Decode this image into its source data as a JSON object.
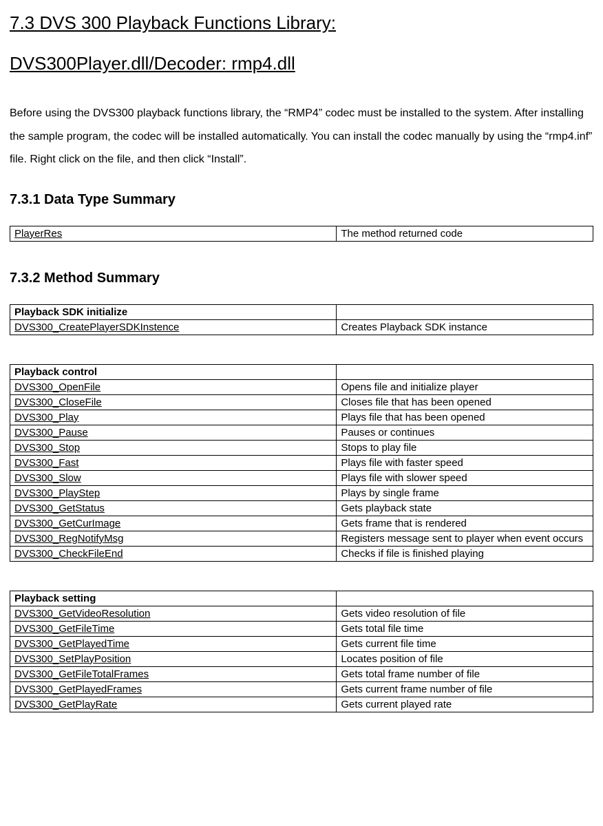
{
  "title": "7.3 DVS 300 Playback Functions Library:",
  "subtitle": "DVS300Player.dll/Decoder: rmp4.dll",
  "intro": "Before using the DVS300 playback functions library, the “RMP4” codec must be installed to the system. After installing the sample program, the codec will be installed automatically. You can install the codec manually by using the “rmp4.inf” file. Right click on the file, and then click “Install”.",
  "sections": {
    "datatype": {
      "heading": "7.3.1 Data Type Summary",
      "rows": [
        {
          "name": "PlayerRes",
          "desc": "The method returned code"
        }
      ]
    },
    "method": {
      "heading": "7.3.2 Method Summary",
      "tables": [
        {
          "header": "Playback SDK initialize",
          "rows": [
            {
              "name": "DVS300_CreatePlayerSDKInstence",
              "desc": "Creates Playback SDK instance"
            }
          ]
        },
        {
          "header": "Playback control",
          "rows": [
            {
              "name": "DVS300_OpenFile",
              "desc": "Opens file and initialize player"
            },
            {
              "name": "DVS300_CloseFile",
              "desc": "Closes file that has been opened"
            },
            {
              "name": "DVS300_Play",
              "desc": "Plays file that has been opened"
            },
            {
              "name": "DVS300_Pause",
              "desc": "Pauses or continues"
            },
            {
              "name": "DVS300_Stop",
              "desc": "Stops to play file"
            },
            {
              "name": "DVS300_Fast",
              "desc": "Plays file with faster speed"
            },
            {
              "name": "DVS300_Slow",
              "desc": "Plays file with slower speed"
            },
            {
              "name": "DVS300_PlayStep",
              "desc": "Plays by single frame"
            },
            {
              "name": "DVS300_GetStatus",
              "desc": "Gets playback state"
            },
            {
              "name": "DVS300_GetCurImage",
              "desc": "Gets frame that is rendered"
            },
            {
              "name": "DVS300_RegNotifyMsg",
              "desc": "Registers message sent to player when event occurs"
            },
            {
              "name": "DVS300_CheckFileEnd",
              "desc": "Checks if file is finished playing"
            }
          ]
        },
        {
          "header": "Playback setting",
          "rows": [
            {
              "name": "DVS300_GetVideoResolution",
              "desc": "Gets video resolution of file"
            },
            {
              "name": "DVS300_GetFileTime",
              "desc": "Gets total file time"
            },
            {
              "name": "DVS300_GetPlayedTime",
              "desc": "Gets current file time"
            },
            {
              "name": "DVS300_SetPlayPosition",
              "desc": "Locates position of file"
            },
            {
              "name": "DVS300_GetFileTotalFrames",
              "desc": "Gets total frame number of file"
            },
            {
              "name": "DVS300_GetPlayedFrames",
              "desc": "Gets current frame number of file"
            },
            {
              "name": "DVS300_GetPlayRate",
              "desc": "Gets current played rate"
            }
          ]
        }
      ]
    }
  }
}
